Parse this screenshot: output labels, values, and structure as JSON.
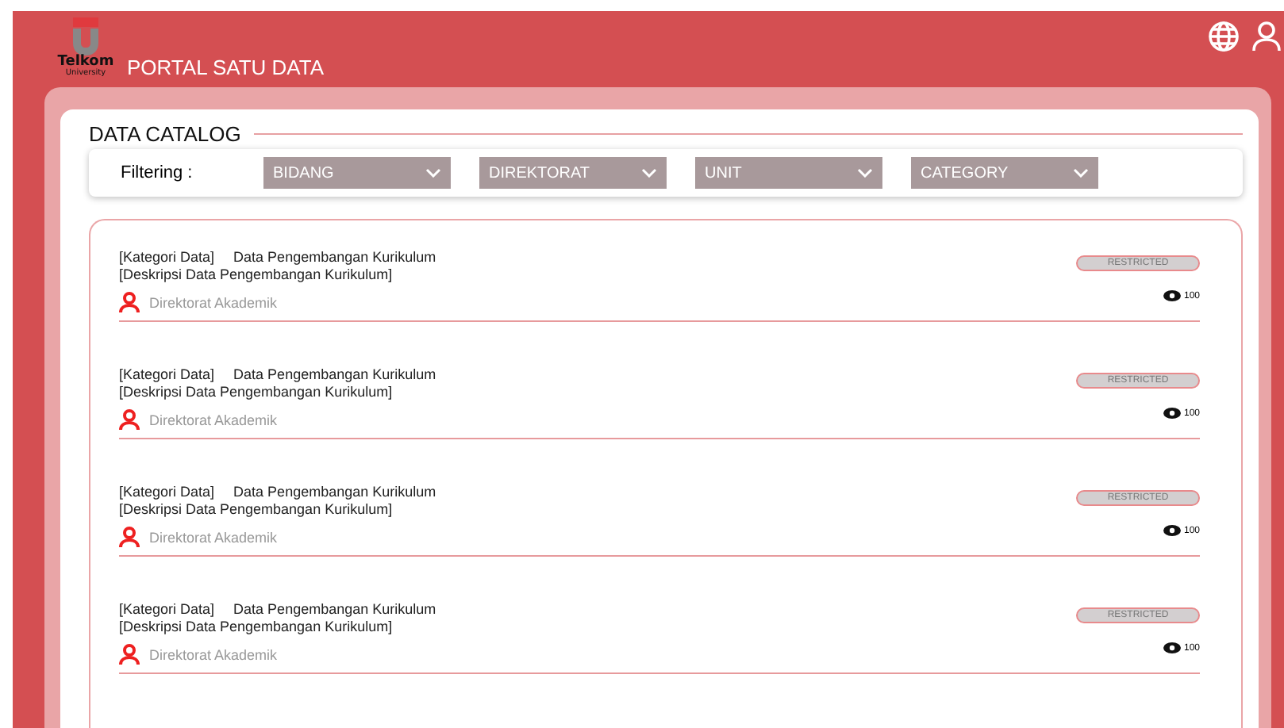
{
  "header": {
    "logo_text": "Telkom",
    "logo_subtext": "University",
    "title": "PORTAL SATU DATA"
  },
  "catalog": {
    "title": "DATA CATALOG",
    "filter_label": "Filtering :",
    "filters": [
      "BIDANG",
      "DIREKTORAT",
      "UNIT",
      "CATEGORY"
    ]
  },
  "items": [
    {
      "category": "[Kategori Data]",
      "name": "Data Pengembangan Kurikulum",
      "description": "[Deskripsi Data Pengembangan Kurikulum]",
      "owner": "Direktorat Akademik",
      "access": "RESTRICTED",
      "views": "100"
    },
    {
      "category": "[Kategori Data]",
      "name": "Data Pengembangan Kurikulum",
      "description": "[Deskripsi Data Pengembangan Kurikulum]",
      "owner": "Direktorat Akademik",
      "access": "RESTRICTED",
      "views": "100"
    },
    {
      "category": "[Kategori Data]",
      "name": "Data Pengembangan Kurikulum",
      "description": "[Deskripsi Data Pengembangan Kurikulum]",
      "owner": "Direktorat Akademik",
      "access": "RESTRICTED",
      "views": "100"
    },
    {
      "category": "[Kategori Data]",
      "name": "Data Pengembangan Kurikulum",
      "description": "[Deskripsi Data Pengembangan Kurikulum]",
      "owner": "Direktorat Akademik",
      "access": "RESTRICTED",
      "views": "100"
    }
  ]
}
